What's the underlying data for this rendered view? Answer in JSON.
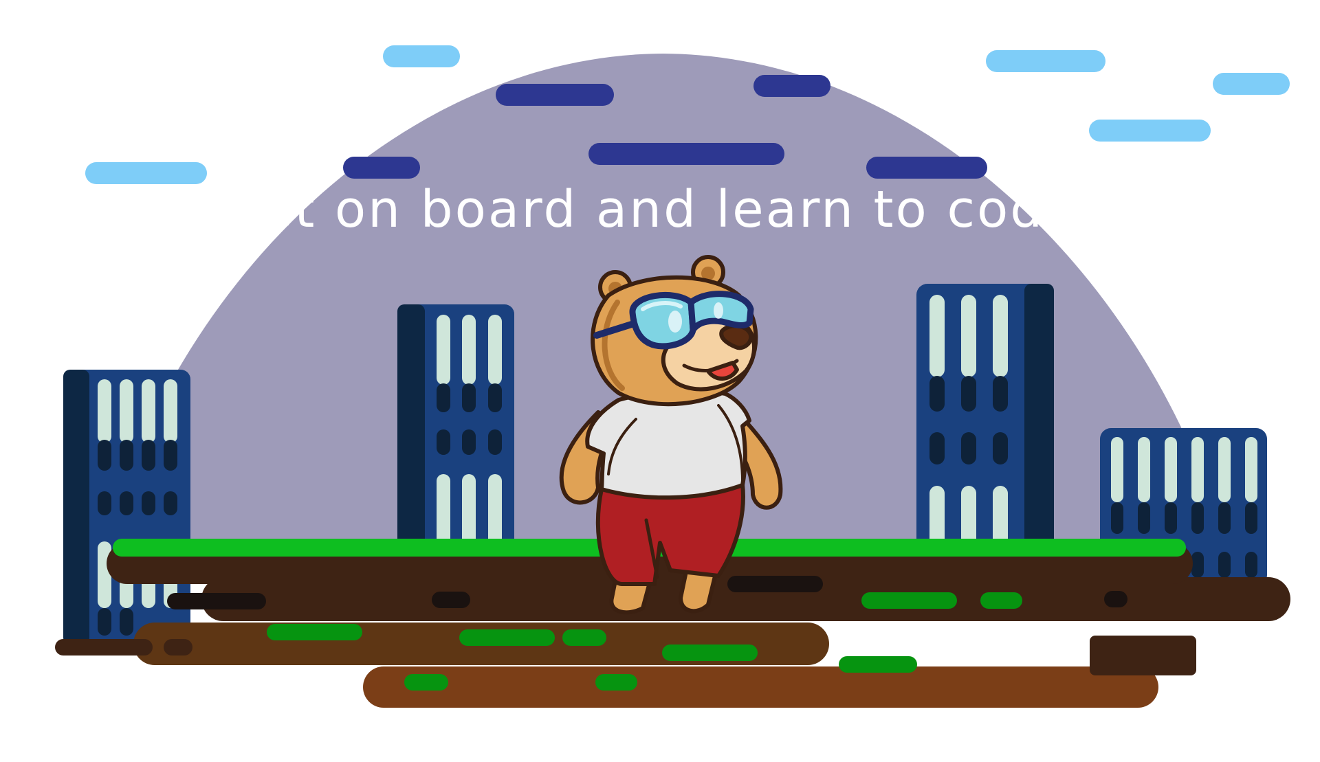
{
  "headline": "Get on board and learn to code!",
  "palette": {
    "dome": "#9e9bb9",
    "cloud_light": "#7ecdf8",
    "cloud_dark": "#2d3791",
    "building": "#1a417f",
    "building_shade": "#0d2744",
    "window_lit": "#cfe6da",
    "window_dark": "#0e2239",
    "grass": "#0ebe20",
    "soil_dark": "#3e2314",
    "soil_mid": "#5e3614",
    "soil_light": "#7b3e17",
    "moss": "#069410",
    "bear_fur": "#e0a255",
    "bear_muzzle": "#f5d2a3",
    "shirt": "#e6e6e6",
    "shorts": "#b01f23",
    "goggle_lens": "#7fd4e3",
    "goggle_frame": "#1e2b6a"
  },
  "icons": [
    "bear-mascot",
    "goggles-icon",
    "building-icon",
    "cloud-icon"
  ]
}
